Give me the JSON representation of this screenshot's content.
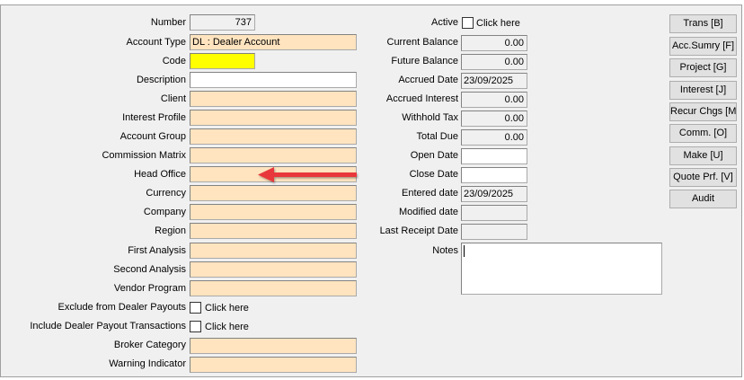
{
  "left": {
    "number": {
      "label": "Number",
      "value": "737"
    },
    "account_type": {
      "label": "Account Type",
      "value": "DL : Dealer Account"
    },
    "code": {
      "label": "Code",
      "value": ""
    },
    "description": {
      "label": "Description",
      "value": ""
    },
    "client": {
      "label": "Client",
      "value": ""
    },
    "interest_profile": {
      "label": "Interest Profile",
      "value": ""
    },
    "account_group": {
      "label": "Account Group",
      "value": ""
    },
    "commission_matrix": {
      "label": "Commission Matrix",
      "value": ""
    },
    "head_office": {
      "label": "Head Office",
      "value": ""
    },
    "currency": {
      "label": "Currency",
      "value": ""
    },
    "company": {
      "label": "Company",
      "value": ""
    },
    "region": {
      "label": "Region",
      "value": ""
    },
    "first_analysis": {
      "label": "First Analysis",
      "value": ""
    },
    "second_analysis": {
      "label": "Second Analysis",
      "value": ""
    },
    "vendor_program": {
      "label": "Vendor Program",
      "value": ""
    },
    "exclude_payouts": {
      "label": "Exclude from Dealer Payouts",
      "check_label": "Click here",
      "checked": false
    },
    "include_payout_tx": {
      "label": "Include Dealer Payout Transactions",
      "check_label": "Click here",
      "checked": false
    },
    "broker_category": {
      "label": "Broker Category",
      "value": ""
    },
    "warning_indicator": {
      "label": "Warning Indicator",
      "value": ""
    }
  },
  "middle": {
    "active": {
      "label": "Active",
      "check_label": "Click here",
      "checked": false
    },
    "current_balance": {
      "label": "Current Balance",
      "value": "0.00"
    },
    "future_balance": {
      "label": "Future Balance",
      "value": "0.00"
    },
    "accrued_date": {
      "label": "Accrued Date",
      "value": "23/09/2025"
    },
    "accrued_interest": {
      "label": "Accrued Interest",
      "value": "0.00"
    },
    "withhold_tax": {
      "label": "Withhold Tax",
      "value": "0.00"
    },
    "total_due": {
      "label": "Total Due",
      "value": "0.00"
    },
    "open_date": {
      "label": "Open Date",
      "value": ""
    },
    "close_date": {
      "label": "Close Date",
      "value": ""
    },
    "entered_date": {
      "label": "Entered date",
      "value": "23/09/2025"
    },
    "modified_date": {
      "label": "Modified date",
      "value": ""
    },
    "last_receipt_date": {
      "label": "Last Receipt Date",
      "value": ""
    },
    "notes": {
      "label": "Notes",
      "value": ""
    }
  },
  "buttons": {
    "trans": "Trans [B]",
    "acc_summary": "Acc.Sumry [F]",
    "project": "Project [G]",
    "interest": "Interest [J]",
    "recur_chgs": "Recur Chgs [M]",
    "comm": "Comm. [O]",
    "make": "Make [U]",
    "quote_prf": "Quote Prf. [V]",
    "audit": "Audit"
  },
  "colors": {
    "required_field": "#ffff00",
    "lookup_field": "#ffe4bf",
    "arrow": "#e8373a"
  },
  "annotation": {
    "icon": "arrow-left-icon"
  }
}
